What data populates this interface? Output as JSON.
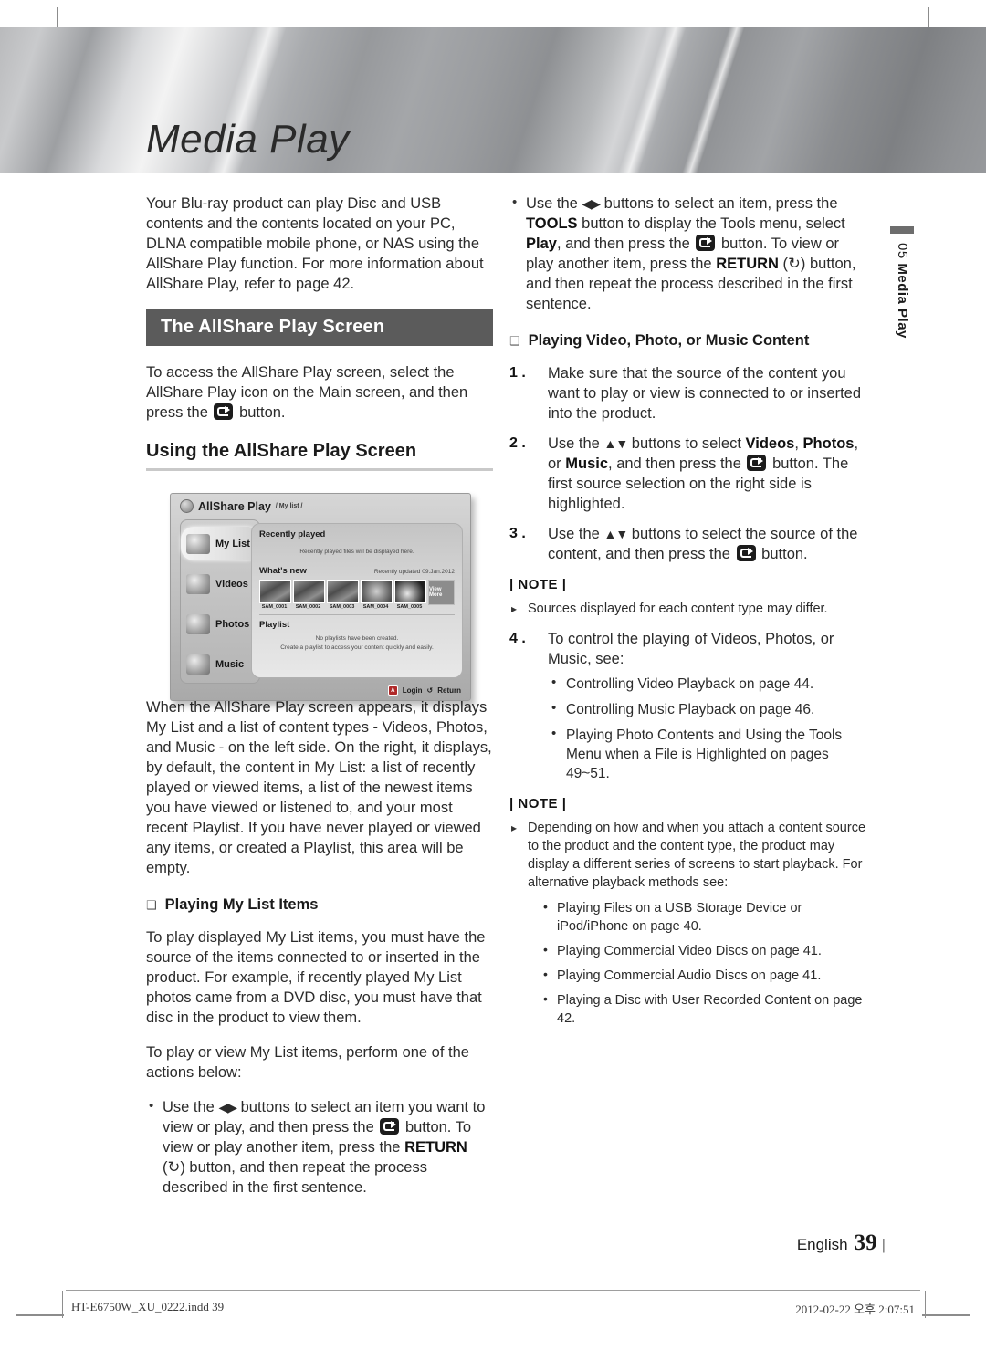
{
  "banner": {
    "title": "Media Play"
  },
  "side_tab": {
    "number": "05",
    "name": "Media Play"
  },
  "left": {
    "intro": "Your Blu-ray product can play Disc and USB contents and the contents located on your PC, DLNA compatible mobile phone, or NAS using the AllShare Play function. For more information about AllShare Play, refer to page 42.",
    "bar_heading": "The AllShare Play Screen",
    "access_1": "To access the AllShare Play screen, select the AllShare Play icon on the Main screen, and then",
    "access_2": "press the",
    "access_3": "button.",
    "sub_heading": "Using the AllShare Play Screen",
    "describe": "When the AllShare Play screen appears, it displays My List and a list of content types - Videos, Photos, and Music - on the left side. On the right, it displays, by default, the content in My List: a list of recently played or viewed items, a list of the newest items you have viewed or listened to, and your most recent Playlist. If you have never played or viewed any items, or created a Playlist, this area will be empty.",
    "mylist_heading": "Playing My List Items",
    "mylist_p1": "To play displayed My List items, you must have the source of the items connected to or inserted in the product. For example, if recently played My List photos came from a DVD disc, you must have that disc in the product to view them.",
    "mylist_p2": "To play or view My List items, perform one of the actions below:",
    "bullet": {
      "a": "Use the",
      "b": "buttons to select an item you want to view or play, and then press the",
      "c": "button. To view or play another item, press the",
      "return": "RETURN",
      "d": "button, and then repeat the process described in the first sentence."
    }
  },
  "screenshot": {
    "app_name": "AllShare Play",
    "breadcrumb": "/ My list /",
    "nav": [
      {
        "label": "My List",
        "selected": true
      },
      {
        "label": "Videos",
        "selected": false
      },
      {
        "label": "Photos",
        "selected": false
      },
      {
        "label": "Music",
        "selected": false
      }
    ],
    "recently_played_title": "Recently played",
    "recently_played_empty": "Recently played files will be displayed here.",
    "whats_new_title": "What's new",
    "whats_new_updated": "Recently updated 09.Jan.2012",
    "thumbnails": [
      "SAM_0001",
      "SAM_0002",
      "SAM_0003",
      "SAM_0004",
      "SAM_0005"
    ],
    "view_more": "View More",
    "playlist_title": "Playlist",
    "playlist_empty_1": "No playlists have been created.",
    "playlist_empty_2": "Create a playlist to access your content quickly and easily.",
    "login_key": "A",
    "login_label": "Login",
    "return_label": "Return"
  },
  "right": {
    "top_bullet": {
      "a": "Use the",
      "b": "buttons to select an item, press the",
      "tools": "TOOLS",
      "c": "button to display the Tools menu, select",
      "play": "Play",
      "d": ", and then press the",
      "e": "button. To view or play another item, press the",
      "return": "RETURN",
      "f": "button, and then repeat the process described in the first sentence."
    },
    "playing_heading": "Playing Video, Photo, or Music Content",
    "steps": [
      {
        "num": "1 .",
        "text": "Make sure that the source of the content you want to play or view is connected to or inserted into the product."
      },
      {
        "num": "2 .",
        "text": "step2"
      },
      {
        "num": "3 .",
        "text": "step3"
      },
      {
        "num": "4 .",
        "text": "To control the playing of Videos, Photos, or Music, see:"
      }
    ],
    "step2": {
      "a": "Use the",
      "b": "buttons to select",
      "videos": "Videos",
      "photos": "Photos",
      "music": "Music",
      "c": ", or",
      "d": ", and then press the",
      "e": "button. The first source selection on the right side is highlighted."
    },
    "step3": {
      "a": "Use the",
      "b": "buttons to select the source of the content, and then press the",
      "c": "button."
    },
    "note_label": "| NOTE |",
    "note1_item": "Sources displayed for each content type may differ.",
    "step4_bullets": [
      "Controlling Video Playback on page 44.",
      "Controlling Music Playback on page 46.",
      "Playing Photo Contents and Using the Tools Menu when a File is Highlighted on pages 49~51."
    ],
    "note2_label": "| NOTE |",
    "note2_item": "Depending on how and when you attach a content source to the product and the content type, the product may display a different series of screens to start playback. For alternative playback methods see:",
    "note2_sub": [
      "Playing Files on a USB Storage Device or iPod/iPhone on page 40.",
      "Playing Commercial Video Discs on page 41.",
      "Playing Commercial Audio Discs on page 41.",
      "Playing a Disc with User Recorded Content on page 42."
    ]
  },
  "footer": {
    "language": "English",
    "page": "39",
    "file": "HT-E6750W_XU_0222.indd   39",
    "timestamp": "2012-02-22   오후 2:07:51"
  }
}
